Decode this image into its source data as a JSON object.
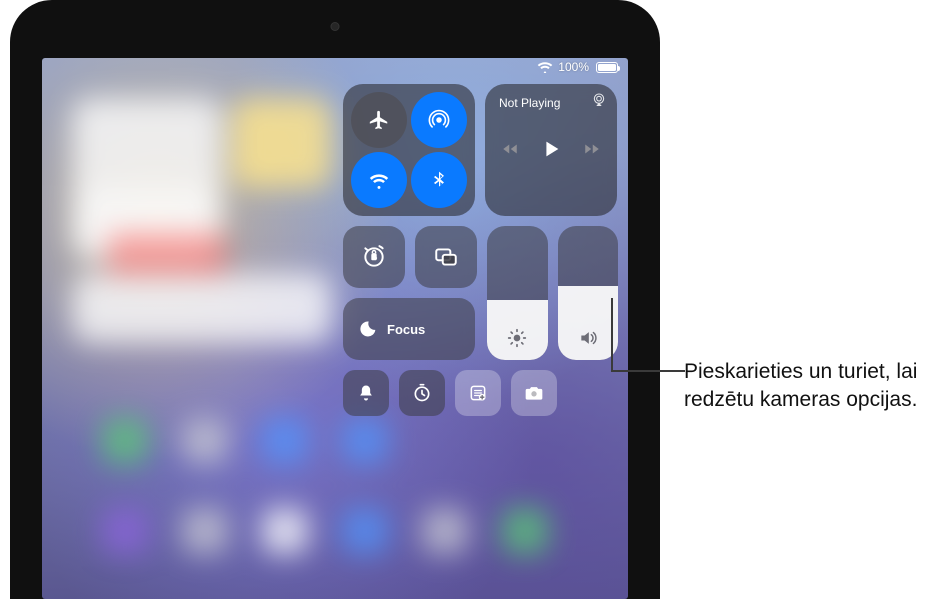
{
  "status": {
    "wifi_icon": "wifi",
    "battery_pct": "100%",
    "battery_level": 1.0
  },
  "connectivity": {
    "airplane": {
      "enabled": false
    },
    "airdrop": {
      "enabled": true
    },
    "wifi": {
      "enabled": true
    },
    "bluetooth": {
      "enabled": true
    }
  },
  "media": {
    "title": "Not Playing",
    "playing": false
  },
  "focus": {
    "label": "Focus",
    "active": false
  },
  "rotation_lock": {
    "locked": false
  },
  "screen_mirroring": {
    "active": false
  },
  "brightness": {
    "level": 0.45
  },
  "volume": {
    "level": 0.55
  },
  "utility": {
    "silent": "silent-mode",
    "timer": "timer",
    "notes": "quick-note",
    "camera": "camera"
  },
  "annotation": {
    "text": "Pieskarieties un turiet, lai redzētu kameras opcijas."
  },
  "colors": {
    "accent_blue": "#0a7aff",
    "tile_dark": "rgba(40,40,45,0.58)",
    "tile_light": "rgba(255,255,255,0.3)"
  }
}
